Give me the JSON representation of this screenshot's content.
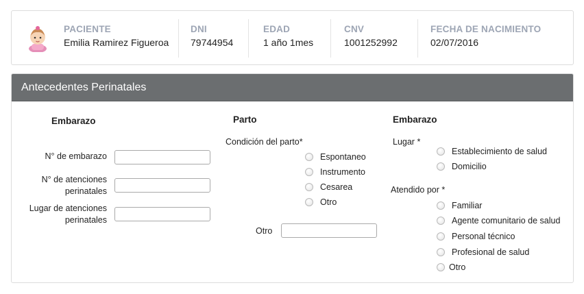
{
  "patient": {
    "name_label": "PACIENTE",
    "name_value": "Emilia Ramirez Figueroa",
    "dni_label": "DNI",
    "dni_value": "79744954",
    "age_label": "EDAD",
    "age_value": "1 año 1mes",
    "cnv_label": "CNV",
    "cnv_value": "1001252992",
    "dob_label": "FECHA DE NACIMIENTO",
    "dob_value": "02/07/2016"
  },
  "section": {
    "title": "Antecedentes Perinatales"
  },
  "embarazo_col": {
    "title": "Embarazo",
    "fields": [
      {
        "label_line1": "N° de embarazo",
        "label_line2": ""
      },
      {
        "label_line1": "N° de atenciones",
        "label_line2": "perinatales"
      },
      {
        "label_line1": "Lugar de atenciones",
        "label_line2": "perinatales"
      }
    ]
  },
  "parto_col": {
    "title": "Parto",
    "condition_label": "Condición del parto*",
    "options": [
      "Espontaneo",
      "Instrumento",
      "Cesarea",
      "Otro"
    ],
    "otro_label": "Otro"
  },
  "lugar_col": {
    "title": "Embarazo",
    "lugar_label": "Lugar *",
    "lugar_options": [
      "Establecimiento de salud",
      "Domicilio"
    ],
    "atendido_label": "Atendido por *",
    "atendido_options": [
      "Familiar",
      "Agente comunitario de salud",
      "Personal técnico",
      "Profesional de salud",
      "Otro"
    ]
  }
}
